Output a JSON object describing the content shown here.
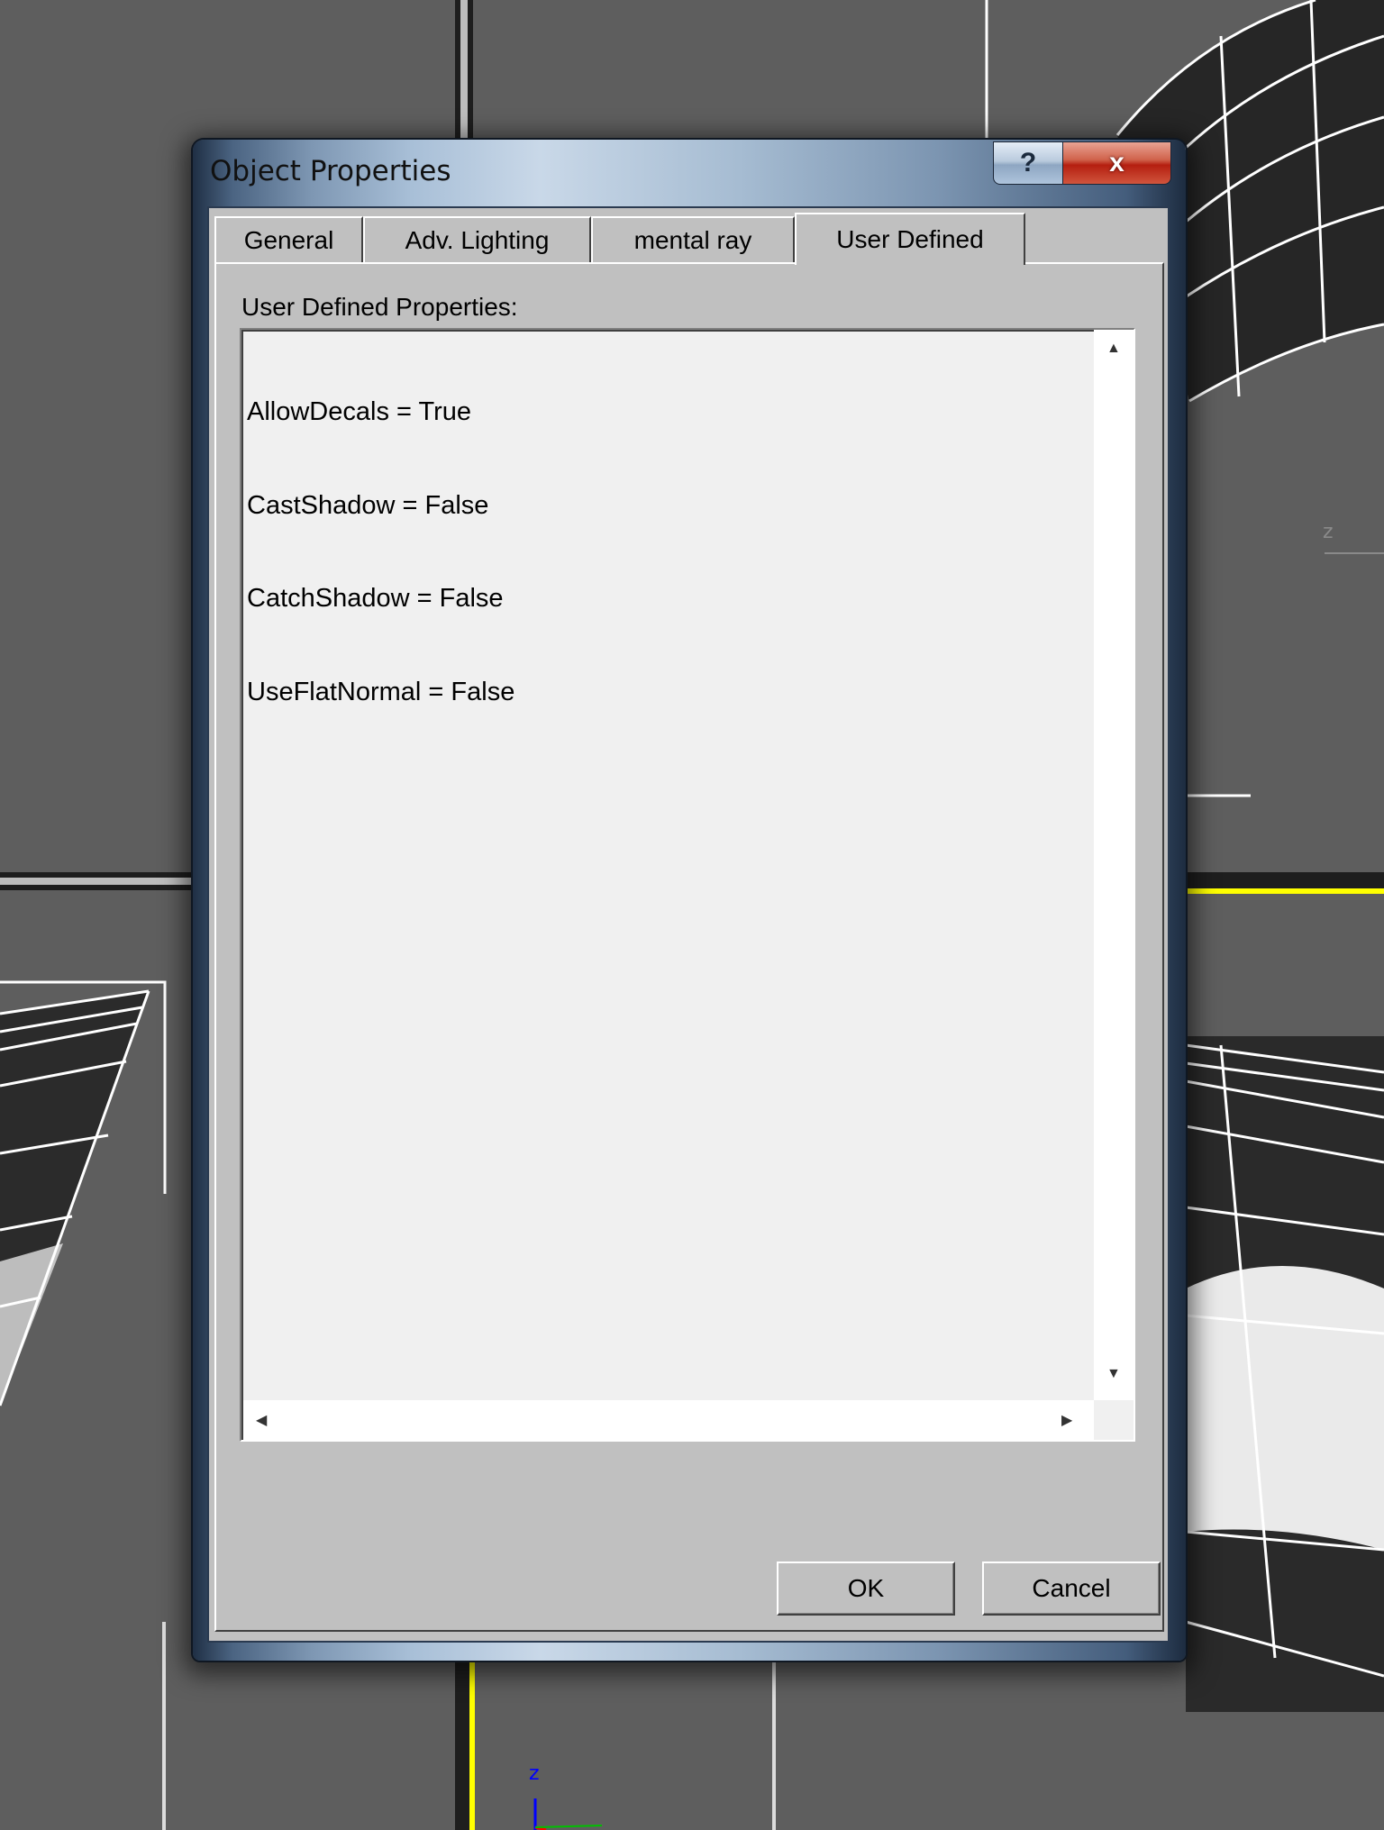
{
  "dialog": {
    "title": "Object Properties",
    "help_label": "?",
    "close_label": "x"
  },
  "tabs": [
    {
      "label": "General",
      "active": false
    },
    {
      "label": "Adv. Lighting",
      "active": false
    },
    {
      "label": "mental ray",
      "active": false
    },
    {
      "label": "User Defined",
      "active": true
    }
  ],
  "user_defined": {
    "section_label": "User Defined Properties:",
    "properties": [
      "AllowDecals = True",
      "CastShadow = False",
      "CatchShadow = False",
      "UseFlatNormal = False"
    ]
  },
  "buttons": {
    "ok_label": "OK",
    "cancel_label": "Cancel"
  },
  "viewport": {
    "axis_label_bottom": "z",
    "axis_label_right": "z",
    "colors": {
      "background": "#5e5e5e",
      "active_border": "#ffff00",
      "wire": "#ffffff",
      "axis_z": "#0000ff"
    }
  }
}
